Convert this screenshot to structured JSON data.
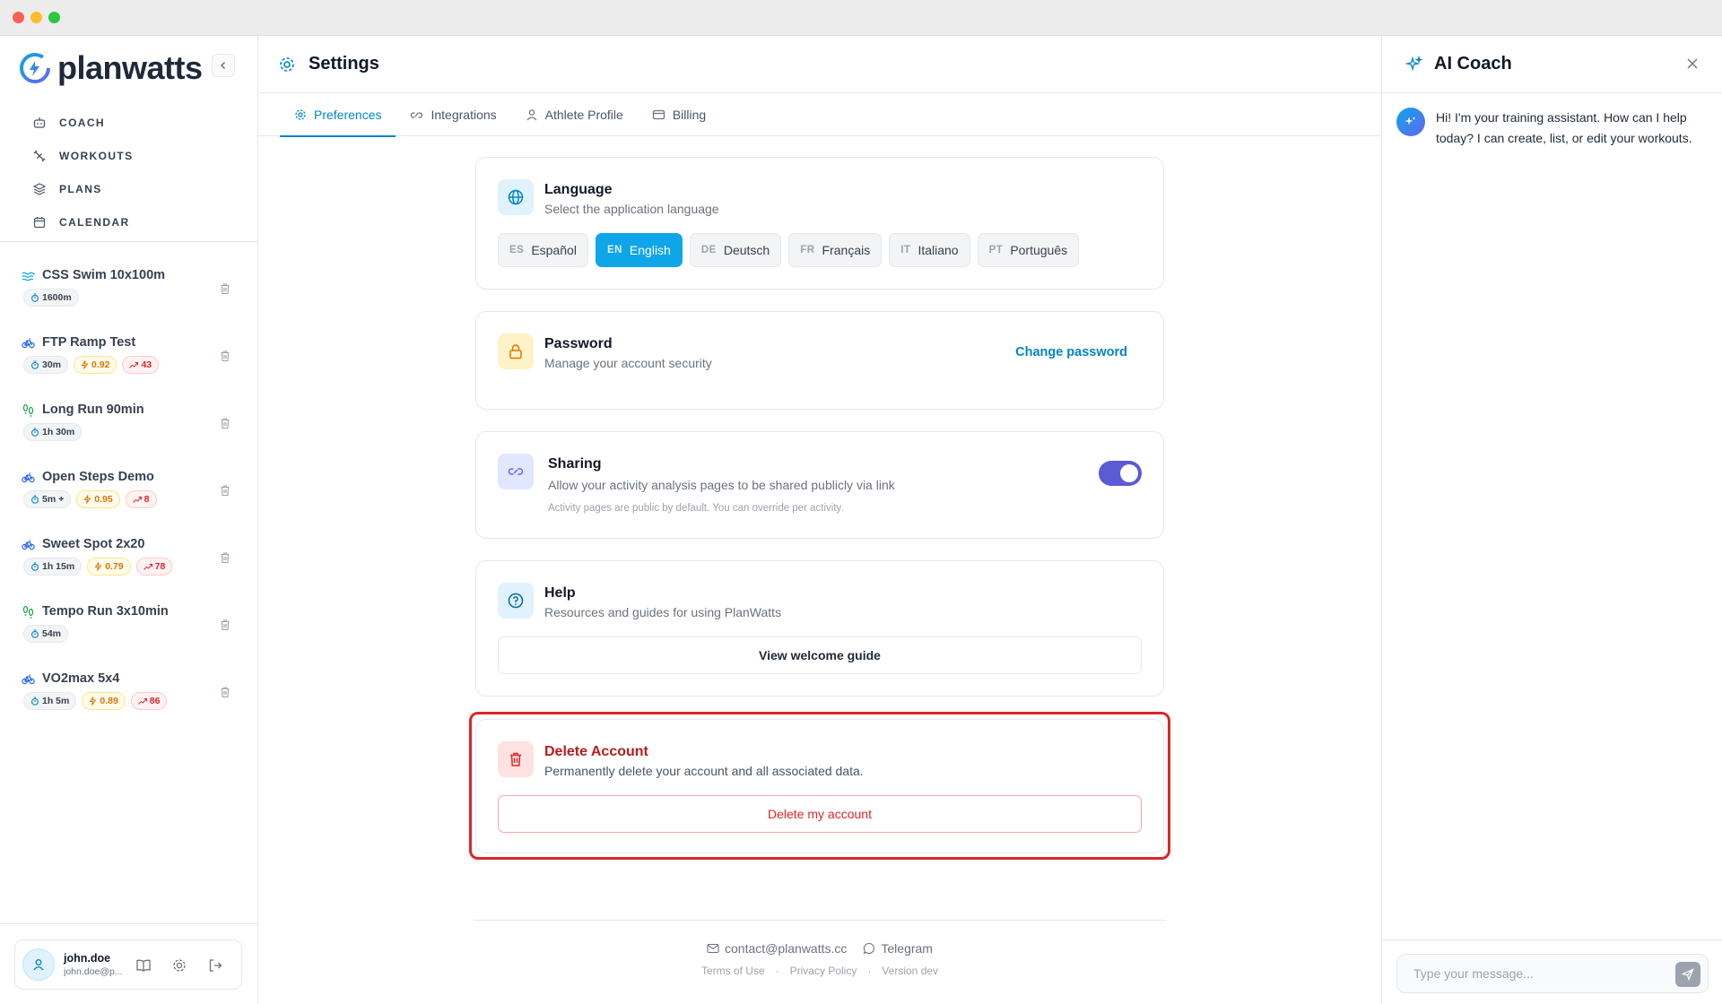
{
  "app": {
    "name": "planwatts"
  },
  "nav": [
    {
      "label": "COACH",
      "icon": "robot-icon"
    },
    {
      "label": "WORKOUTS",
      "icon": "dumbbell-icon"
    },
    {
      "label": "PLANS",
      "icon": "layers-icon"
    },
    {
      "label": "CALENDAR",
      "icon": "calendar-icon"
    }
  ],
  "workouts": [
    {
      "title": "CSS Swim 10x100m",
      "sport": "swim",
      "duration": "1600m"
    },
    {
      "title": "FTP Ramp Test",
      "sport": "bike",
      "duration": "30m",
      "if": "0.92",
      "tss": "43"
    },
    {
      "title": "Long Run 90min",
      "sport": "run",
      "duration": "1h 30m"
    },
    {
      "title": "Open Steps Demo",
      "sport": "bike",
      "duration": "5m +",
      "if": "0.95",
      "tss": "8"
    },
    {
      "title": "Sweet Spot 2x20",
      "sport": "bike",
      "duration": "1h 15m",
      "if": "0.79",
      "tss": "78"
    },
    {
      "title": "Tempo Run 3x10min",
      "sport": "run",
      "duration": "54m"
    },
    {
      "title": "VO2max 5x4",
      "sport": "bike",
      "duration": "1h 5m",
      "if": "0.89",
      "tss": "86"
    }
  ],
  "user": {
    "name": "john.doe",
    "email": "john.doe@p..."
  },
  "header": {
    "title": "Settings"
  },
  "tabs": [
    {
      "label": "Preferences",
      "icon": "gear-icon"
    },
    {
      "label": "Integrations",
      "icon": "link-icon"
    },
    {
      "label": "Athlete Profile",
      "icon": "person-icon"
    },
    {
      "label": "Billing",
      "icon": "card-icon"
    }
  ],
  "language": {
    "title": "Language",
    "subtitle": "Select the application language",
    "options": [
      {
        "code": "ES",
        "name": "Español"
      },
      {
        "code": "EN",
        "name": "English",
        "active": true
      },
      {
        "code": "DE",
        "name": "Deutsch"
      },
      {
        "code": "FR",
        "name": "Français"
      },
      {
        "code": "IT",
        "name": "Italiano"
      },
      {
        "code": "PT",
        "name": "Português"
      }
    ]
  },
  "password": {
    "title": "Password",
    "subtitle": "Manage your account security",
    "action": "Change password"
  },
  "sharing": {
    "title": "Sharing",
    "subtitle": "Allow your activity analysis pages to be shared publicly via link",
    "note": "Activity pages are public by default. You can override per activity.",
    "enabled": true
  },
  "help": {
    "title": "Help",
    "subtitle": "Resources and guides for using PlanWatts",
    "action": "View welcome guide"
  },
  "delete": {
    "title": "Delete Account",
    "subtitle": "Permanently delete your account and all associated data.",
    "action": "Delete my account"
  },
  "footer": {
    "email": "contact@planwatts.cc",
    "telegram": "Telegram",
    "terms": "Terms of Use",
    "privacy": "Privacy Policy",
    "version": "Version dev",
    "sep": "·"
  },
  "coach": {
    "title": "AI Coach",
    "message": "Hi! I'm your training assistant. How can I help today? I can create, list, or edit your workouts.",
    "input_placeholder": "Type your message..."
  },
  "colors": {
    "accent": "#0284c7",
    "danger": "#dc2626",
    "toggle": "#5b5bd6"
  }
}
